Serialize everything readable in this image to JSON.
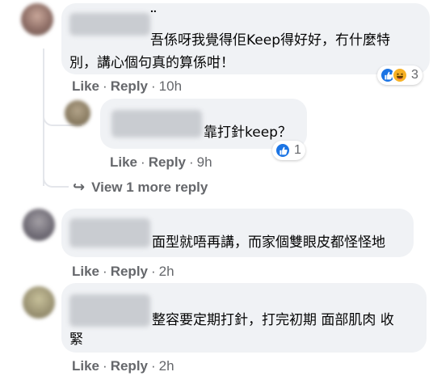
{
  "comments": [
    {
      "text_line1": "吾係呀我覺得佢Keep得好好，冇什麼特",
      "text_line2": "別，講心個句真的算係咁！",
      "like": "Like",
      "reply": "Reply",
      "sep": "·",
      "time": "10h",
      "reactions": [
        "like",
        "haha"
      ],
      "reaction_count": "3"
    },
    {
      "text": "靠打針keep？",
      "like": "Like",
      "reply": "Reply",
      "sep": "·",
      "time": "9h",
      "reactions": [
        "like"
      ],
      "reaction_count": "1"
    },
    {
      "text": "面型就唔再講，而家個雙眼皮都怪怪地",
      "like": "Like",
      "reply": "Reply",
      "sep": "·",
      "time": "2h"
    },
    {
      "text_line1": "整容要定期打針，打完初期 面部肌肉 收",
      "text_line2": "緊",
      "like": "Like",
      "reply": "Reply",
      "sep": "·",
      "time": "2h"
    }
  ],
  "view_more": {
    "arrow": "↪",
    "label": "View 1 more reply"
  },
  "colors": {
    "bubble": "#f0f2f5",
    "meta_text": "#65676b",
    "like_blue": "#1b74e4",
    "haha_yellow": "#f7b125"
  }
}
